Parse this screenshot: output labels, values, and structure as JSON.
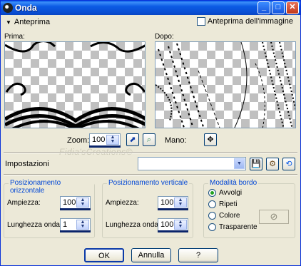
{
  "window": {
    "title": "Onda"
  },
  "preview": {
    "toggle_label": "Anteprima",
    "image_preview_checkbox": "Anteprima dell'immagine",
    "before_label": "Prima:",
    "after_label": "Dopo:"
  },
  "zoom": {
    "label": "Zoom:",
    "value": "100",
    "hand_label": "Mano:"
  },
  "watermark": "Fidia'sCreations©",
  "settings": {
    "label": "Impostazioni",
    "value": ""
  },
  "horizontal": {
    "title": "Posizionamento orizzontale",
    "amplitude_label": "Ampiezza:",
    "amplitude_value": "100",
    "wavelength_label": "Lunghezza onda:",
    "wavelength_value": "1"
  },
  "vertical": {
    "title": "Posizionamento verticale",
    "amplitude_label": "Ampiezza:",
    "amplitude_value": "100",
    "wavelength_label": "Lunghezza onda:",
    "wavelength_value": "100"
  },
  "edge_mode": {
    "title": "Modalità bordo",
    "options": [
      "Avvolgi",
      "Ripeti",
      "Colore",
      "Trasparente"
    ],
    "selected": "Avvolgi"
  },
  "buttons": {
    "ok": "OK",
    "cancel": "Annulla",
    "help": "?"
  },
  "colors": {
    "accent": "#0046d5",
    "titlebar": "#0a5ce8",
    "face": "#ece9d8"
  }
}
